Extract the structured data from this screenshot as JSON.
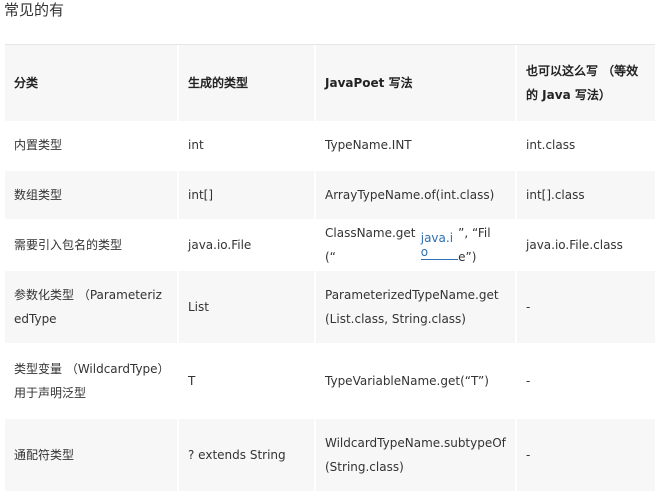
{
  "heading": "常见的有",
  "table": {
    "headers": [
      "分类",
      "生成的类型",
      "JavaPoet 写法",
      "也可以这么写 （等效的 Java 写法）"
    ],
    "rows": [
      {
        "category": "内置类型",
        "type": "int",
        "javapoet": "TypeName.INT",
        "java": "int.class"
      },
      {
        "category": "数组类型",
        "type": "int[]",
        "javapoet": "ArrayTypeName.of(int.class)",
        "java": "int[].class"
      },
      {
        "category": "需要引入包名的类型",
        "type": "java.io.File",
        "javapoet_pre": "ClassName.get(“",
        "javapoet_link": "java.io",
        "javapoet_post": "”, “File”)",
        "java": "java.io.File.class"
      },
      {
        "category": "参数化类型 （ParameterizedType",
        "type": "List",
        "javapoet": "ParameterizedTypeName.get(List.class, String.class)",
        "java": "-"
      },
      {
        "category": "类型变量 （WildcardType）用于声明泛型",
        "type": "T",
        "javapoet": "TypeVariableName.get(“T”)",
        "java": "-"
      },
      {
        "category": "通配符类型",
        "type": "? extends String",
        "javapoet": "WildcardTypeName.subtypeOf(String.class)",
        "java": "-"
      }
    ]
  }
}
